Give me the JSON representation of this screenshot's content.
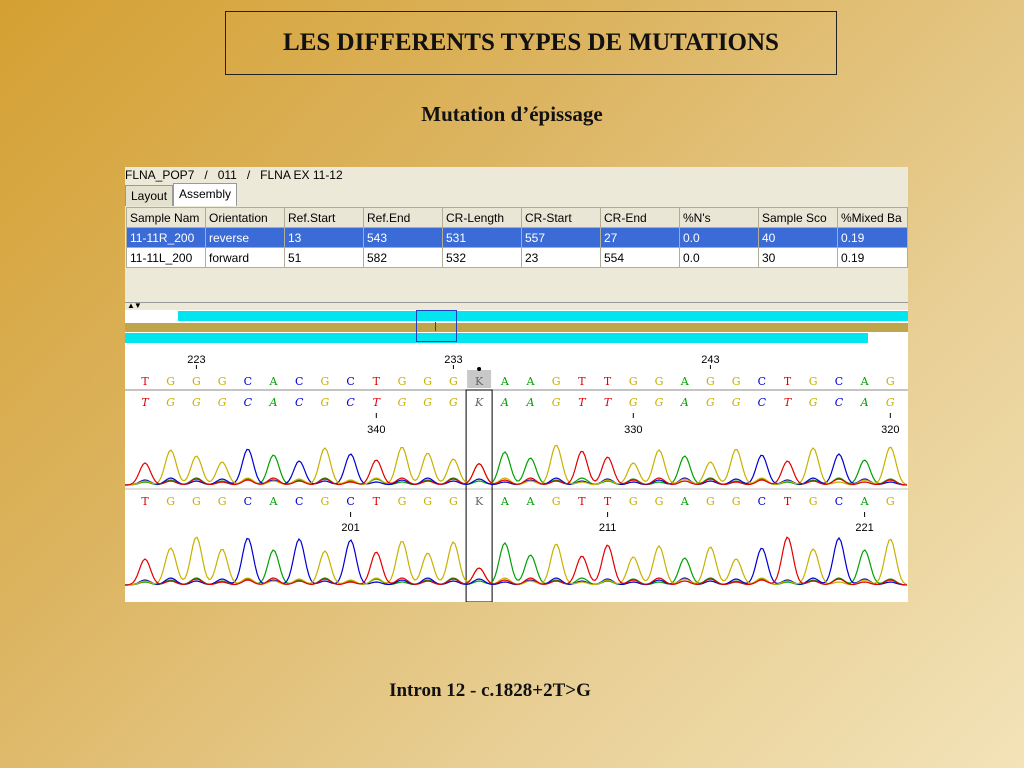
{
  "slide": {
    "title": "LES DIFFERENTS TYPES DE MUTATIONS",
    "subtitle": "Mutation d’épissage",
    "caption": "Intron 12 - c.1828+2T>G"
  },
  "app": {
    "path": "FLNA_POP7   /   011   /   FLNA EX 11-12",
    "tabs": [
      {
        "label": "Layout",
        "active": false
      },
      {
        "label": "Assembly",
        "active": true
      }
    ],
    "columns": [
      "Sample Nam",
      "Orientation",
      "Ref.Start",
      "Ref.End",
      "CR-Length",
      "CR-Start",
      "CR-End",
      "%N's",
      "Sample Sco",
      "%Mixed Ba"
    ],
    "rows": [
      {
        "selected": true,
        "cells": [
          "11-11R_200",
          "reverse",
          "13",
          "543",
          "531",
          "557",
          "27",
          "0.0",
          "40",
          "0.19"
        ]
      },
      {
        "selected": false,
        "cells": [
          "11-11L_200",
          "forward",
          "51",
          "582",
          "532",
          "23",
          "554",
          "0.0",
          "30",
          "0.19"
        ]
      }
    ]
  },
  "sequence": {
    "bases": [
      "T",
      "G",
      "G",
      "G",
      "C",
      "A",
      "C",
      "G",
      "C",
      "T",
      "G",
      "G",
      "G",
      "K",
      "A",
      "A",
      "G",
      "T",
      "T",
      "G",
      "G",
      "A",
      "G",
      "G",
      "C",
      "T",
      "G",
      "C",
      "A",
      "G"
    ],
    "ref_numbers": [
      "223",
      "233",
      "243"
    ],
    "rev_numbers": [
      "340",
      "330",
      "320"
    ],
    "fwd_numbers": [
      "201",
      "211",
      "221"
    ],
    "base_colors": {
      "A": "#00a000",
      "C": "#0000d0",
      "G": "#c8b000",
      "T": "#e00000",
      "K": "#666666"
    },
    "toolbar_marker": "▲▼"
  }
}
